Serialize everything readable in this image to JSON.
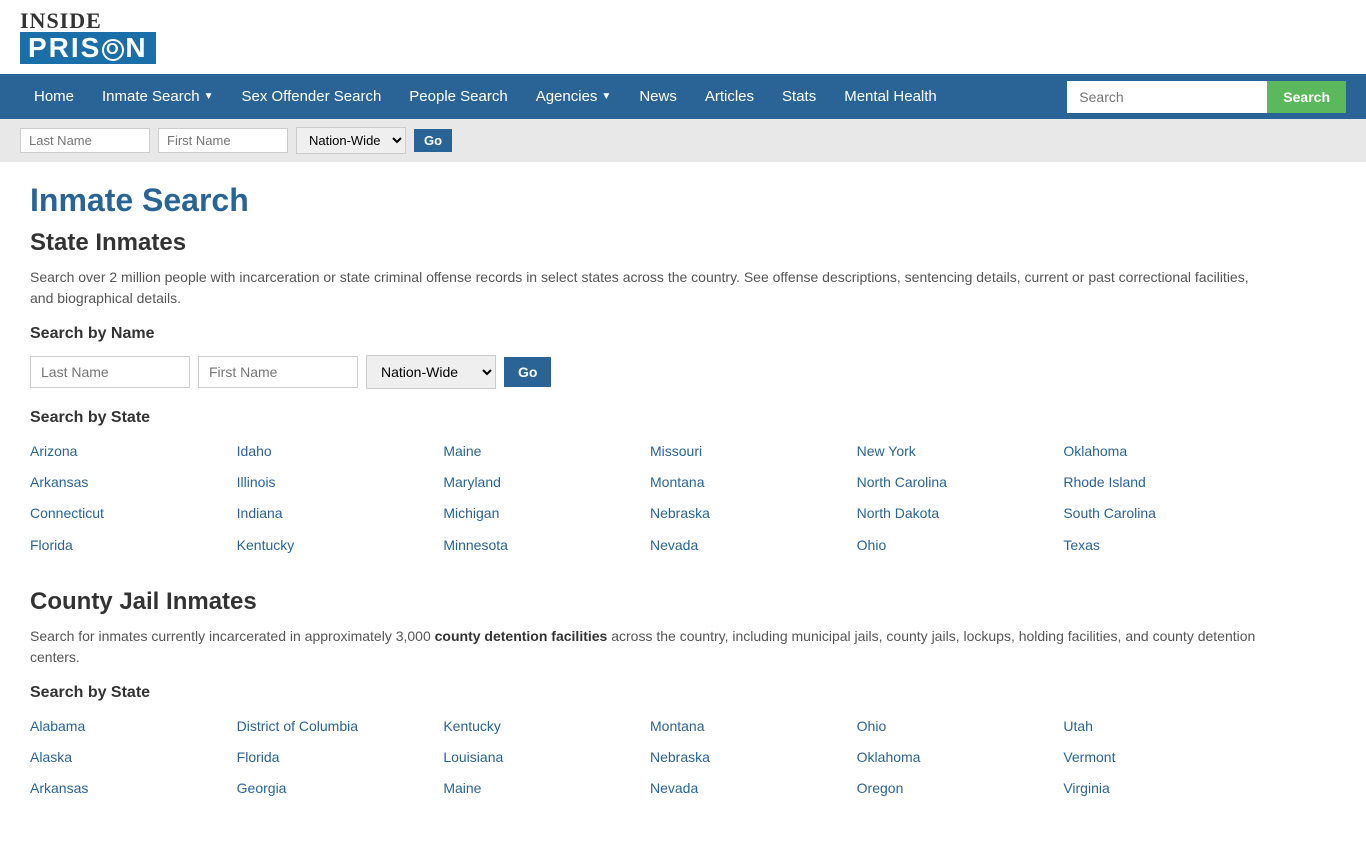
{
  "logo": {
    "inside": "INSIDE",
    "prison": "PRISN"
  },
  "navbar": {
    "items": [
      {
        "label": "Home",
        "has_dropdown": false
      },
      {
        "label": "Inmate Search",
        "has_dropdown": true
      },
      {
        "label": "Sex Offender Search",
        "has_dropdown": false
      },
      {
        "label": "People Search",
        "has_dropdown": false
      },
      {
        "label": "Agencies",
        "has_dropdown": true
      },
      {
        "label": "News",
        "has_dropdown": false
      },
      {
        "label": "Articles",
        "has_dropdown": false
      },
      {
        "label": "Stats",
        "has_dropdown": false
      },
      {
        "label": "Mental Health",
        "has_dropdown": false
      }
    ],
    "search_placeholder": "Search",
    "search_btn_label": "Search"
  },
  "quick_search": {
    "last_name_placeholder": "Last Name",
    "first_name_placeholder": "First Name",
    "scope_default": "Nation-Wide",
    "go_label": "Go"
  },
  "page": {
    "title": "Inmate Search",
    "state_section_title": "State Inmates",
    "state_description": "Search over 2 million people with incarceration or state criminal offense records in select states across the country. See offense descriptions, sentencing details, current or past correctional facilities, and biographical details.",
    "search_by_name_label": "Search by Name",
    "last_name_placeholder": "Last Name",
    "first_name_placeholder": "First Name",
    "scope_default": "Nation-Wide",
    "go_label": "Go",
    "search_by_state_label": "Search by State",
    "state_inmates": [
      [
        "Arizona",
        "Idaho",
        "Maine",
        "Missouri",
        "New York",
        "Oklahoma"
      ],
      [
        "Arkansas",
        "Illinois",
        "Maryland",
        "Montana",
        "North Carolina",
        "Rhode Island"
      ],
      [
        "Connecticut",
        "Indiana",
        "Michigan",
        "Nebraska",
        "North Dakota",
        "South Carolina"
      ],
      [
        "Florida",
        "Kentucky",
        "Minnesota",
        "Nevada",
        "Ohio",
        "Texas"
      ]
    ],
    "county_section_title": "County Jail Inmates",
    "county_description_prefix": "Search for inmates currently incarcerated in approximately 3,000 ",
    "county_description_bold": "county detention facilities",
    "county_description_suffix": " across the country, including municipal jails, county jails, lockups, holding facilities, and county detention centers.",
    "county_search_by_state_label": "Search by State",
    "county_inmates": [
      [
        "Alabama",
        "District of Columbia",
        "Kentucky",
        "Montana",
        "Ohio",
        "Utah"
      ],
      [
        "Alaska",
        "Florida",
        "Louisiana",
        "Nebraska",
        "Oklahoma",
        "Vermont"
      ],
      [
        "Arkansas",
        "Georgia",
        "Maine",
        "Nevada",
        "Oregon",
        "Virginia"
      ]
    ]
  }
}
